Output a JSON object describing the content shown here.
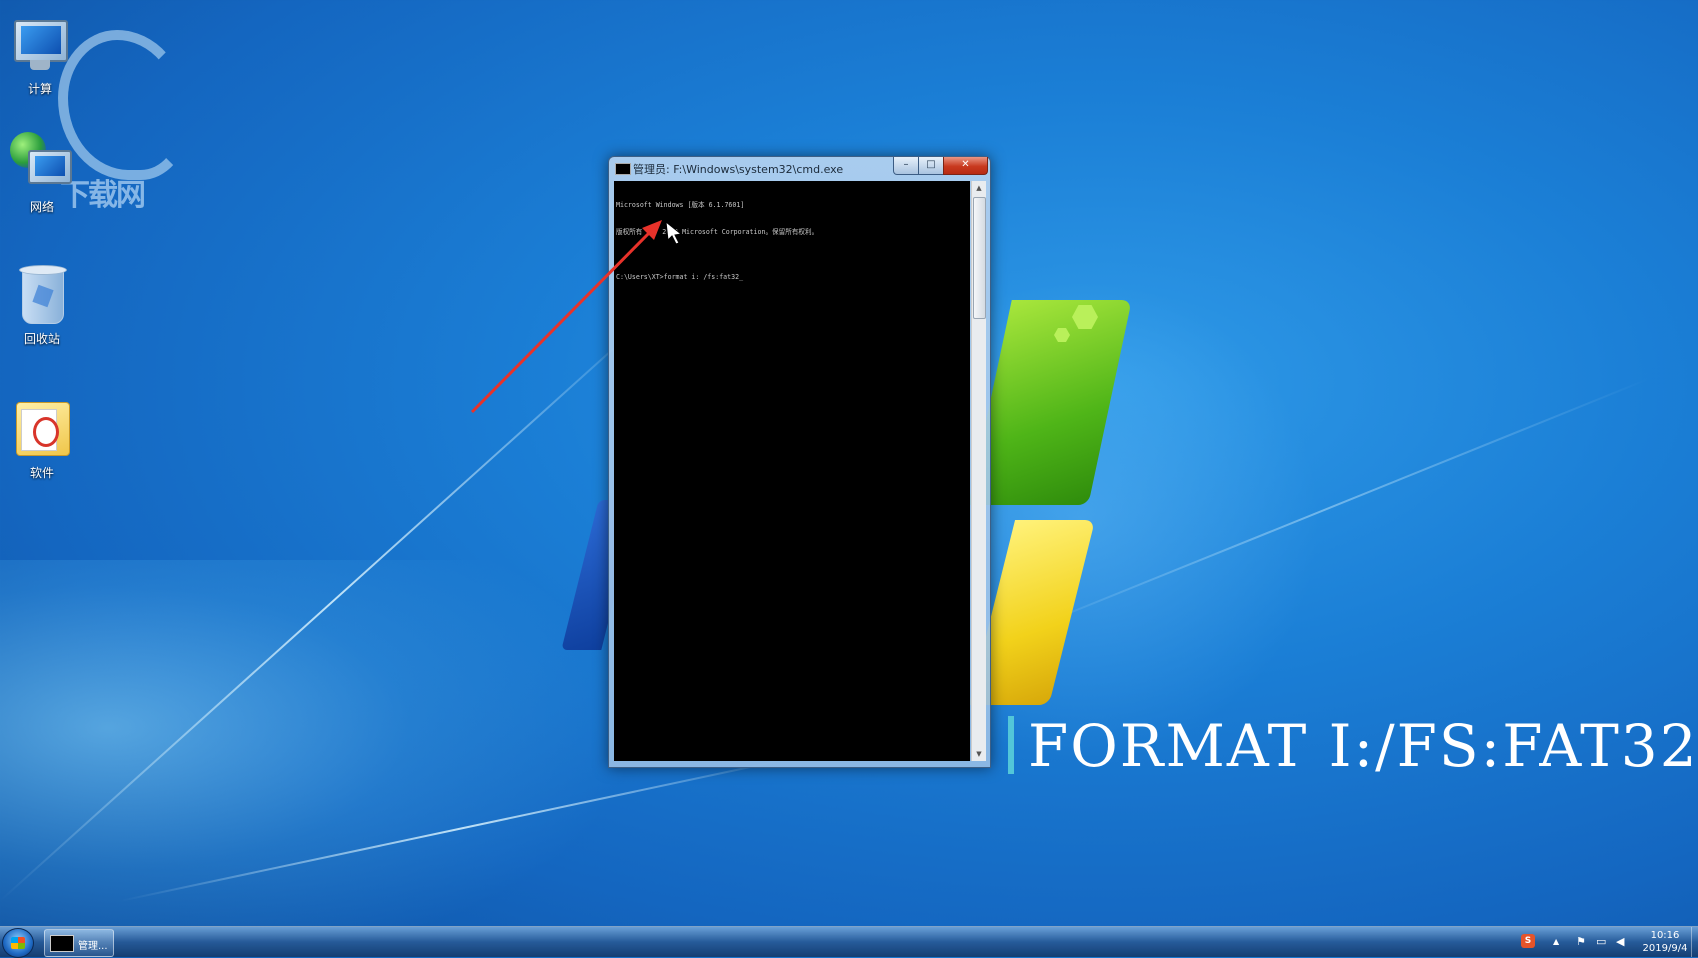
{
  "desktop": {
    "icons": [
      {
        "label": "计算",
        "icon": "computer-icon"
      },
      {
        "label": "网络",
        "icon": "network-icon"
      },
      {
        "label": "回收站",
        "icon": "recycle-bin-icon"
      },
      {
        "label": "软件",
        "icon": "folder-icon"
      }
    ],
    "watermark_text": "下载网"
  },
  "cmd_window": {
    "title": "管理员: F:\\Windows\\system32\\cmd.exe",
    "buttons": {
      "minimize": "–",
      "maximize": "□",
      "close": "✕"
    },
    "console_lines": [
      "Microsoft Windows [版本 6.1.7601]",
      "版权所有 (c) 2009 Microsoft Corporation。保留所有权利。",
      "",
      "C:\\Users\\XT>format i: /fs:fat32_"
    ],
    "scroll_up": "▲",
    "scroll_down": "▼"
  },
  "caption": {
    "text": "FORMAT I:/FS:FAT32",
    "accent_color": "#52c6d9"
  },
  "annotation": {
    "arrow_color": "#e8322a"
  },
  "taskbar": {
    "task_label": "管理...",
    "tray": {
      "ime": "S",
      "up_arrow": "▲",
      "flag": "⚑",
      "network": "▭",
      "volume": "◀"
    },
    "clock": {
      "time": "10:16",
      "date": "2019/9/4"
    }
  }
}
